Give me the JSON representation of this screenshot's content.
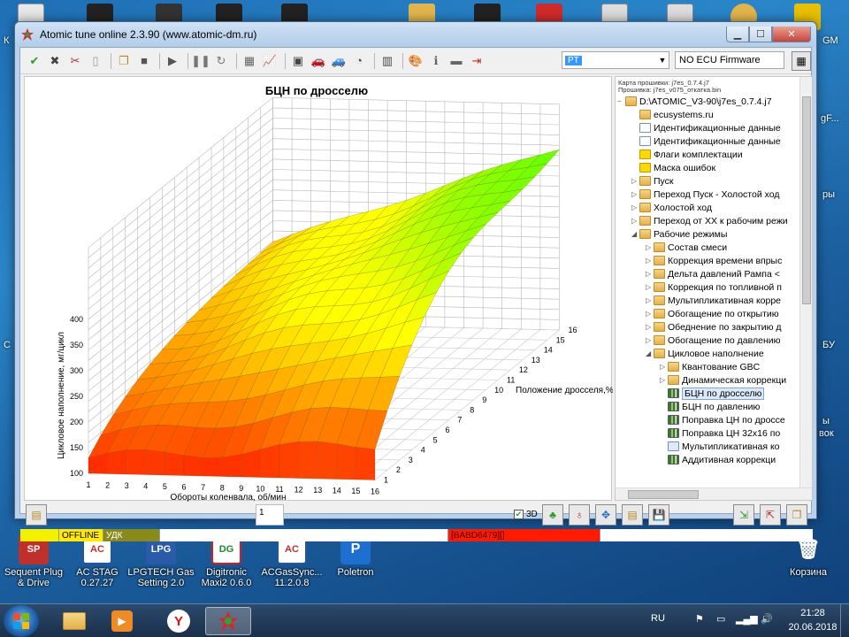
{
  "window": {
    "title": "Atomic tune online 2.3.90 (www.atomic-dm.ru)",
    "buttons": {
      "minimize": "▁",
      "maximize": "☐",
      "close": "✕"
    }
  },
  "toolbar": {
    "combo_value": "PT",
    "firmware_label": "NO ECU Firmware"
  },
  "chart": {
    "title": "БЦН по дросселю"
  },
  "tree": {
    "header_line1": "Карта прошивки: j7es_0.7.4.j7",
    "header_line2": "Прошивка: j7es_v075_откатка.bin",
    "items": [
      {
        "label": "D:\\ATOMIC_V3-90\\j7es_0.7.4.j7",
        "icon": "folder",
        "expander": "−",
        "depth": 0
      },
      {
        "label": "ecusystems.ru",
        "icon": "folder",
        "expander": "",
        "depth": 1
      },
      {
        "label": "Идентификационные данные",
        "icon": "doc",
        "expander": "",
        "depth": 1
      },
      {
        "label": "Идентификационные данные",
        "icon": "doc",
        "expander": "",
        "depth": 1
      },
      {
        "label": "Флаги комплектации",
        "icon": "flag",
        "expander": "",
        "depth": 1
      },
      {
        "label": "Маска ошибок",
        "icon": "flag",
        "expander": "",
        "depth": 1
      },
      {
        "label": "Пуск",
        "icon": "folder",
        "expander": "▷",
        "depth": 1
      },
      {
        "label": "Переход Пуск - Холостой ход",
        "icon": "folder",
        "expander": "▷",
        "depth": 1
      },
      {
        "label": "Холостой ход",
        "icon": "folder",
        "expander": "▷",
        "depth": 1
      },
      {
        "label": "Переход от ХХ к рабочим режи",
        "icon": "folder",
        "expander": "▷",
        "depth": 1
      },
      {
        "label": "Рабочие режимы",
        "icon": "folder",
        "expander": "◢",
        "depth": 1
      },
      {
        "label": "Состав смеси",
        "icon": "folder",
        "expander": "▷",
        "depth": 2
      },
      {
        "label": "Коррекция времени впрыс",
        "icon": "folder",
        "expander": "▷",
        "depth": 2
      },
      {
        "label": "Дельта давлений Рампа <",
        "icon": "folder",
        "expander": "▷",
        "depth": 2
      },
      {
        "label": "Коррекция по топливной п",
        "icon": "folder",
        "expander": "▷",
        "depth": 2
      },
      {
        "label": "Мультипликативная корре",
        "icon": "folder",
        "expander": "▷",
        "depth": 2
      },
      {
        "label": "Обогащение по открытию",
        "icon": "folder",
        "expander": "▷",
        "depth": 2
      },
      {
        "label": "Обеднение по закрытию д",
        "icon": "folder",
        "expander": "▷",
        "depth": 2
      },
      {
        "label": "Обогащение по давлению",
        "icon": "folder",
        "expander": "▷",
        "depth": 2
      },
      {
        "label": "Цикловое наполнение",
        "icon": "folder",
        "expander": "◢",
        "depth": 2
      },
      {
        "label": "Квантование GBC",
        "icon": "folder",
        "expander": "▷",
        "depth": 3
      },
      {
        "label": "Динамическая коррекци",
        "icon": "folder",
        "expander": "▷",
        "depth": 3
      },
      {
        "label": "БЦН по дросселю",
        "icon": "chart",
        "expander": "",
        "depth": 3,
        "selected": true
      },
      {
        "label": "БЦН по давлению",
        "icon": "chart",
        "expander": "",
        "depth": 3
      },
      {
        "label": "Поправка ЦН по дроссе",
        "icon": "chart",
        "expander": "",
        "depth": 3
      },
      {
        "label": "Поправка ЦН 32x16 по",
        "icon": "chart",
        "expander": "",
        "depth": 3
      },
      {
        "label": "Мультипликативная ко",
        "icon": "wave",
        "expander": "",
        "depth": 3
      },
      {
        "label": "Аддитивная коррекци",
        "icon": "chart",
        "expander": "",
        "depth": 3
      }
    ]
  },
  "bottom": {
    "page_value": "1",
    "toggle_3d_label": "3D",
    "toggle_3d_checked": true
  },
  "status": {
    "seg2": "OFFLINE",
    "seg3": "УДК",
    "seg5": "[BABD6479][]"
  },
  "desktop": {
    "icons": [
      {
        "label": "Sequent Plug & Drive",
        "color": "#c0302a",
        "text": "SP"
      },
      {
        "label": "AC STAG 0.27.27",
        "color": "#ffffff",
        "text": "AC"
      },
      {
        "label": "LPGTECH Gas Setting 2.0",
        "color": "#2a5aa8",
        "text": "LPG"
      },
      {
        "label": "Digitronic Maxi2 0.6.0",
        "color": "#ffffff",
        "text": "DG"
      },
      {
        "label": "ACGasSync... 11.2.0.8",
        "color": "#ffffff",
        "text": "AC"
      },
      {
        "label": "Poletron",
        "color": "#1d6fd0",
        "text": "P"
      },
      {
        "label": "Корзина",
        "color": "#cfe3f5",
        "text": "🗑"
      }
    ],
    "right_fragments": [
      "GM",
      "gF...",
      "ры",
      "БУ",
      "ы",
      "вок"
    ],
    "left_fragments": [
      "К",
      "С"
    ]
  },
  "taskbar": {
    "lang": "RU",
    "time": "21:28",
    "date": "20.06.2018"
  }
}
